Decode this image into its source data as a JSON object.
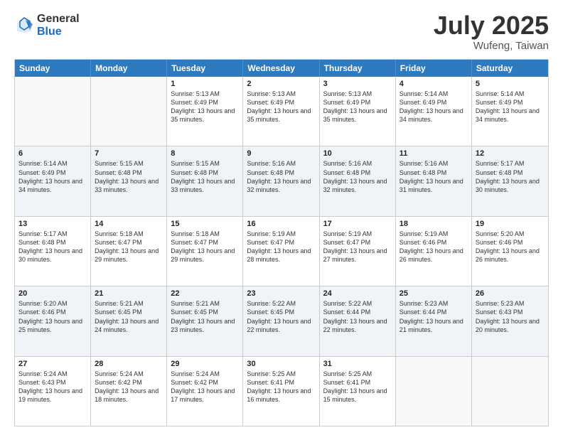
{
  "logo": {
    "general": "General",
    "blue": "Blue"
  },
  "title": "July 2025",
  "subtitle": "Wufeng, Taiwan",
  "days": [
    "Sunday",
    "Monday",
    "Tuesday",
    "Wednesday",
    "Thursday",
    "Friday",
    "Saturday"
  ],
  "rows": [
    [
      {
        "day": "",
        "empty": true,
        "text": ""
      },
      {
        "day": "",
        "empty": true,
        "text": ""
      },
      {
        "day": "1",
        "text": "Sunrise: 5:13 AM\nSunset: 6:49 PM\nDaylight: 13 hours and 35 minutes."
      },
      {
        "day": "2",
        "text": "Sunrise: 5:13 AM\nSunset: 6:49 PM\nDaylight: 13 hours and 35 minutes."
      },
      {
        "day": "3",
        "text": "Sunrise: 5:13 AM\nSunset: 6:49 PM\nDaylight: 13 hours and 35 minutes."
      },
      {
        "day": "4",
        "text": "Sunrise: 5:14 AM\nSunset: 6:49 PM\nDaylight: 13 hours and 34 minutes."
      },
      {
        "day": "5",
        "text": "Sunrise: 5:14 AM\nSunset: 6:49 PM\nDaylight: 13 hours and 34 minutes."
      }
    ],
    [
      {
        "day": "6",
        "text": "Sunrise: 5:14 AM\nSunset: 6:49 PM\nDaylight: 13 hours and 34 minutes."
      },
      {
        "day": "7",
        "text": "Sunrise: 5:15 AM\nSunset: 6:48 PM\nDaylight: 13 hours and 33 minutes."
      },
      {
        "day": "8",
        "text": "Sunrise: 5:15 AM\nSunset: 6:48 PM\nDaylight: 13 hours and 33 minutes."
      },
      {
        "day": "9",
        "text": "Sunrise: 5:16 AM\nSunset: 6:48 PM\nDaylight: 13 hours and 32 minutes."
      },
      {
        "day": "10",
        "text": "Sunrise: 5:16 AM\nSunset: 6:48 PM\nDaylight: 13 hours and 32 minutes."
      },
      {
        "day": "11",
        "text": "Sunrise: 5:16 AM\nSunset: 6:48 PM\nDaylight: 13 hours and 31 minutes."
      },
      {
        "day": "12",
        "text": "Sunrise: 5:17 AM\nSunset: 6:48 PM\nDaylight: 13 hours and 30 minutes."
      }
    ],
    [
      {
        "day": "13",
        "text": "Sunrise: 5:17 AM\nSunset: 6:48 PM\nDaylight: 13 hours and 30 minutes."
      },
      {
        "day": "14",
        "text": "Sunrise: 5:18 AM\nSunset: 6:47 PM\nDaylight: 13 hours and 29 minutes."
      },
      {
        "day": "15",
        "text": "Sunrise: 5:18 AM\nSunset: 6:47 PM\nDaylight: 13 hours and 29 minutes."
      },
      {
        "day": "16",
        "text": "Sunrise: 5:19 AM\nSunset: 6:47 PM\nDaylight: 13 hours and 28 minutes."
      },
      {
        "day": "17",
        "text": "Sunrise: 5:19 AM\nSunset: 6:47 PM\nDaylight: 13 hours and 27 minutes."
      },
      {
        "day": "18",
        "text": "Sunrise: 5:19 AM\nSunset: 6:46 PM\nDaylight: 13 hours and 26 minutes."
      },
      {
        "day": "19",
        "text": "Sunrise: 5:20 AM\nSunset: 6:46 PM\nDaylight: 13 hours and 26 minutes."
      }
    ],
    [
      {
        "day": "20",
        "text": "Sunrise: 5:20 AM\nSunset: 6:46 PM\nDaylight: 13 hours and 25 minutes."
      },
      {
        "day": "21",
        "text": "Sunrise: 5:21 AM\nSunset: 6:45 PM\nDaylight: 13 hours and 24 minutes."
      },
      {
        "day": "22",
        "text": "Sunrise: 5:21 AM\nSunset: 6:45 PM\nDaylight: 13 hours and 23 minutes."
      },
      {
        "day": "23",
        "text": "Sunrise: 5:22 AM\nSunset: 6:45 PM\nDaylight: 13 hours and 22 minutes."
      },
      {
        "day": "24",
        "text": "Sunrise: 5:22 AM\nSunset: 6:44 PM\nDaylight: 13 hours and 22 minutes."
      },
      {
        "day": "25",
        "text": "Sunrise: 5:23 AM\nSunset: 6:44 PM\nDaylight: 13 hours and 21 minutes."
      },
      {
        "day": "26",
        "text": "Sunrise: 5:23 AM\nSunset: 6:43 PM\nDaylight: 13 hours and 20 minutes."
      }
    ],
    [
      {
        "day": "27",
        "text": "Sunrise: 5:24 AM\nSunset: 6:43 PM\nDaylight: 13 hours and 19 minutes."
      },
      {
        "day": "28",
        "text": "Sunrise: 5:24 AM\nSunset: 6:42 PM\nDaylight: 13 hours and 18 minutes."
      },
      {
        "day": "29",
        "text": "Sunrise: 5:24 AM\nSunset: 6:42 PM\nDaylight: 13 hours and 17 minutes."
      },
      {
        "day": "30",
        "text": "Sunrise: 5:25 AM\nSunset: 6:41 PM\nDaylight: 13 hours and 16 minutes."
      },
      {
        "day": "31",
        "text": "Sunrise: 5:25 AM\nSunset: 6:41 PM\nDaylight: 13 hours and 15 minutes."
      },
      {
        "day": "",
        "empty": true,
        "text": ""
      },
      {
        "day": "",
        "empty": true,
        "text": ""
      }
    ]
  ]
}
